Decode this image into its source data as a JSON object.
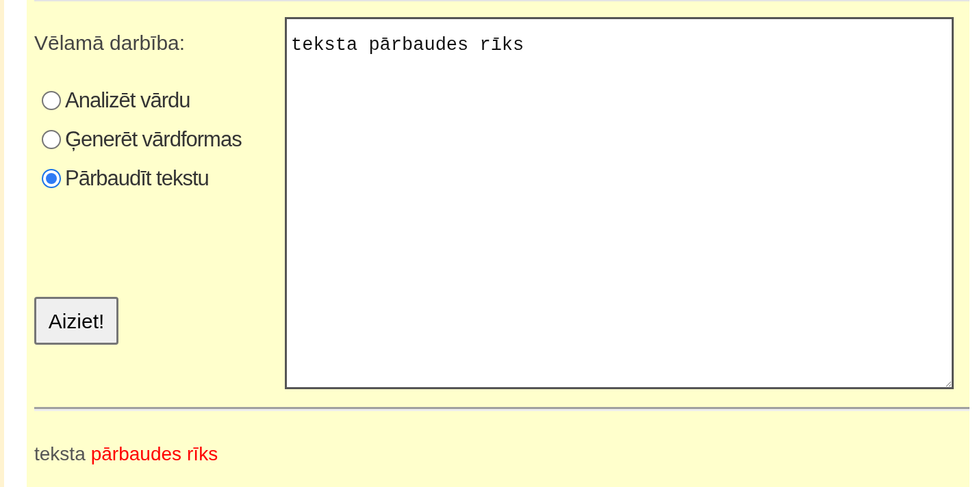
{
  "form": {
    "label": "Vēlamā darbība:",
    "options": [
      {
        "label": "Analizēt vārdu",
        "selected": false
      },
      {
        "label": "Ģenerēt vārdformas",
        "selected": false
      },
      {
        "label": "Pārbaudīt tekstu",
        "selected": true
      }
    ],
    "submit": "Aiziet!",
    "text_input": {
      "value": "teksta pārbaudes rīks"
    }
  },
  "result": {
    "words": [
      {
        "text": "teksta",
        "error": false
      },
      {
        "text": "pārbaudes",
        "error": true
      },
      {
        "text": "rīks",
        "error": true
      }
    ]
  }
}
